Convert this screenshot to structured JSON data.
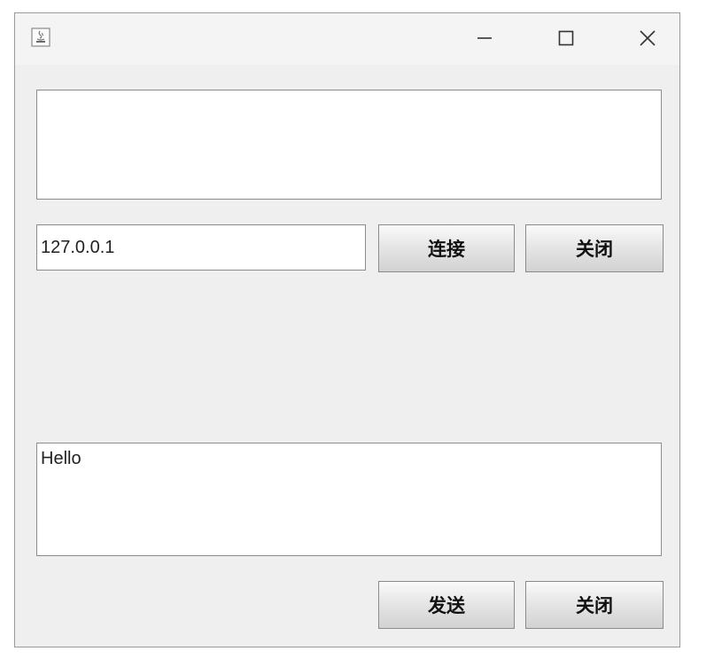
{
  "window": {
    "controls": {
      "minimize_icon": "minimize-icon",
      "maximize_icon": "maximize-icon",
      "close_icon": "close-icon"
    }
  },
  "received_area": {
    "value": ""
  },
  "connection": {
    "ip_value": "127.0.0.1",
    "connect_label": "连接",
    "close_label": "关闭"
  },
  "message": {
    "value": "Hello",
    "send_label": "发送",
    "close_label": "关闭"
  }
}
